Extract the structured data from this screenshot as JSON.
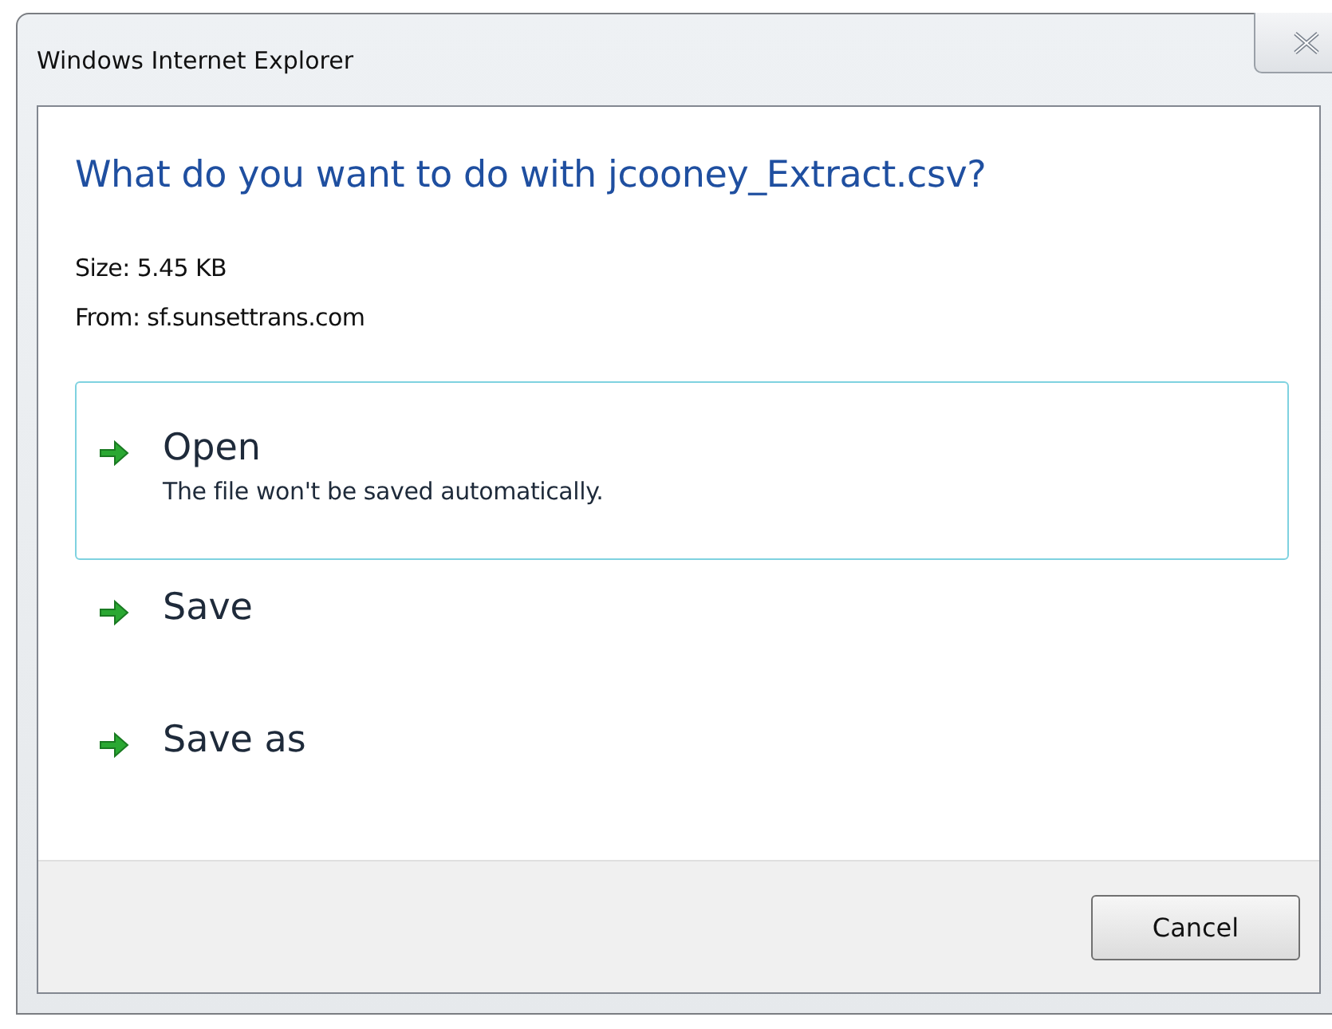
{
  "window": {
    "title": "Windows Internet Explorer"
  },
  "question": "What do you want to do with jcooney_Extract.csv?",
  "details": [
    "Size: 5.45 KB",
    "From: sf.sunsettrans.com"
  ],
  "options": [
    {
      "label": "Open",
      "description": "The file won't be saved automatically.",
      "selected": true
    },
    {
      "label": "Save",
      "selected": false
    },
    {
      "label": "Save as",
      "selected": false
    }
  ],
  "buttons": [
    "Cancel"
  ]
}
